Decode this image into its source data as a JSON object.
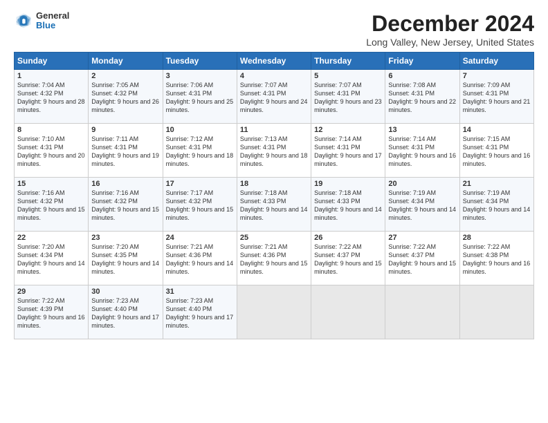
{
  "logo": {
    "general": "General",
    "blue": "Blue"
  },
  "title": "December 2024",
  "subtitle": "Long Valley, New Jersey, United States",
  "days_header": [
    "Sunday",
    "Monday",
    "Tuesday",
    "Wednesday",
    "Thursday",
    "Friday",
    "Saturday"
  ],
  "weeks": [
    [
      {
        "day": "1",
        "rise": "Sunrise: 7:04 AM",
        "set": "Sunset: 4:32 PM",
        "daylight": "Daylight: 9 hours and 28 minutes."
      },
      {
        "day": "2",
        "rise": "Sunrise: 7:05 AM",
        "set": "Sunset: 4:32 PM",
        "daylight": "Daylight: 9 hours and 26 minutes."
      },
      {
        "day": "3",
        "rise": "Sunrise: 7:06 AM",
        "set": "Sunset: 4:31 PM",
        "daylight": "Daylight: 9 hours and 25 minutes."
      },
      {
        "day": "4",
        "rise": "Sunrise: 7:07 AM",
        "set": "Sunset: 4:31 PM",
        "daylight": "Daylight: 9 hours and 24 minutes."
      },
      {
        "day": "5",
        "rise": "Sunrise: 7:07 AM",
        "set": "Sunset: 4:31 PM",
        "daylight": "Daylight: 9 hours and 23 minutes."
      },
      {
        "day": "6",
        "rise": "Sunrise: 7:08 AM",
        "set": "Sunset: 4:31 PM",
        "daylight": "Daylight: 9 hours and 22 minutes."
      },
      {
        "day": "7",
        "rise": "Sunrise: 7:09 AM",
        "set": "Sunset: 4:31 PM",
        "daylight": "Daylight: 9 hours and 21 minutes."
      }
    ],
    [
      {
        "day": "8",
        "rise": "Sunrise: 7:10 AM",
        "set": "Sunset: 4:31 PM",
        "daylight": "Daylight: 9 hours and 20 minutes."
      },
      {
        "day": "9",
        "rise": "Sunrise: 7:11 AM",
        "set": "Sunset: 4:31 PM",
        "daylight": "Daylight: 9 hours and 19 minutes."
      },
      {
        "day": "10",
        "rise": "Sunrise: 7:12 AM",
        "set": "Sunset: 4:31 PM",
        "daylight": "Daylight: 9 hours and 18 minutes."
      },
      {
        "day": "11",
        "rise": "Sunrise: 7:13 AM",
        "set": "Sunset: 4:31 PM",
        "daylight": "Daylight: 9 hours and 18 minutes."
      },
      {
        "day": "12",
        "rise": "Sunrise: 7:14 AM",
        "set": "Sunset: 4:31 PM",
        "daylight": "Daylight: 9 hours and 17 minutes."
      },
      {
        "day": "13",
        "rise": "Sunrise: 7:14 AM",
        "set": "Sunset: 4:31 PM",
        "daylight": "Daylight: 9 hours and 16 minutes."
      },
      {
        "day": "14",
        "rise": "Sunrise: 7:15 AM",
        "set": "Sunset: 4:31 PM",
        "daylight": "Daylight: 9 hours and 16 minutes."
      }
    ],
    [
      {
        "day": "15",
        "rise": "Sunrise: 7:16 AM",
        "set": "Sunset: 4:32 PM",
        "daylight": "Daylight: 9 hours and 15 minutes."
      },
      {
        "day": "16",
        "rise": "Sunrise: 7:16 AM",
        "set": "Sunset: 4:32 PM",
        "daylight": "Daylight: 9 hours and 15 minutes."
      },
      {
        "day": "17",
        "rise": "Sunrise: 7:17 AM",
        "set": "Sunset: 4:32 PM",
        "daylight": "Daylight: 9 hours and 15 minutes."
      },
      {
        "day": "18",
        "rise": "Sunrise: 7:18 AM",
        "set": "Sunset: 4:33 PM",
        "daylight": "Daylight: 9 hours and 14 minutes."
      },
      {
        "day": "19",
        "rise": "Sunrise: 7:18 AM",
        "set": "Sunset: 4:33 PM",
        "daylight": "Daylight: 9 hours and 14 minutes."
      },
      {
        "day": "20",
        "rise": "Sunrise: 7:19 AM",
        "set": "Sunset: 4:34 PM",
        "daylight": "Daylight: 9 hours and 14 minutes."
      },
      {
        "day": "21",
        "rise": "Sunrise: 7:19 AM",
        "set": "Sunset: 4:34 PM",
        "daylight": "Daylight: 9 hours and 14 minutes."
      }
    ],
    [
      {
        "day": "22",
        "rise": "Sunrise: 7:20 AM",
        "set": "Sunset: 4:34 PM",
        "daylight": "Daylight: 9 hours and 14 minutes."
      },
      {
        "day": "23",
        "rise": "Sunrise: 7:20 AM",
        "set": "Sunset: 4:35 PM",
        "daylight": "Daylight: 9 hours and 14 minutes."
      },
      {
        "day": "24",
        "rise": "Sunrise: 7:21 AM",
        "set": "Sunset: 4:36 PM",
        "daylight": "Daylight: 9 hours and 14 minutes."
      },
      {
        "day": "25",
        "rise": "Sunrise: 7:21 AM",
        "set": "Sunset: 4:36 PM",
        "daylight": "Daylight: 9 hours and 15 minutes."
      },
      {
        "day": "26",
        "rise": "Sunrise: 7:22 AM",
        "set": "Sunset: 4:37 PM",
        "daylight": "Daylight: 9 hours and 15 minutes."
      },
      {
        "day": "27",
        "rise": "Sunrise: 7:22 AM",
        "set": "Sunset: 4:37 PM",
        "daylight": "Daylight: 9 hours and 15 minutes."
      },
      {
        "day": "28",
        "rise": "Sunrise: 7:22 AM",
        "set": "Sunset: 4:38 PM",
        "daylight": "Daylight: 9 hours and 16 minutes."
      }
    ],
    [
      {
        "day": "29",
        "rise": "Sunrise: 7:22 AM",
        "set": "Sunset: 4:39 PM",
        "daylight": "Daylight: 9 hours and 16 minutes."
      },
      {
        "day": "30",
        "rise": "Sunrise: 7:23 AM",
        "set": "Sunset: 4:40 PM",
        "daylight": "Daylight: 9 hours and 17 minutes."
      },
      {
        "day": "31",
        "rise": "Sunrise: 7:23 AM",
        "set": "Sunset: 4:40 PM",
        "daylight": "Daylight: 9 hours and 17 minutes."
      },
      null,
      null,
      null,
      null
    ]
  ]
}
